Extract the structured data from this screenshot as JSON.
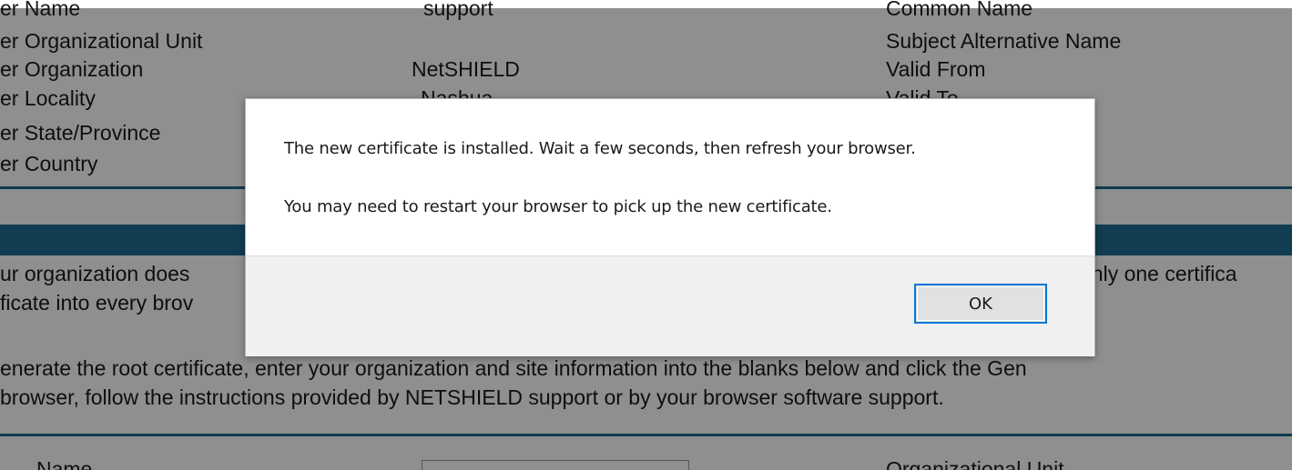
{
  "background": {
    "left_labels": [
      "er Name",
      "er Organizational Unit",
      "er Organization",
      "er Locality",
      "er State/Province",
      "er Country"
    ],
    "mid_values": [
      "support",
      "NetSHIELD",
      "Nashua"
    ],
    "right_labels": [
      "Common Name",
      "Subject Alternative Name",
      "Valid From",
      "Valid To"
    ],
    "paragraph1": [
      "ur organization does",
      "ficate into every brov",
      "only one certifica"
    ],
    "paragraph2": [
      "enerate the root certificate, enter your organization and site information into the blanks below and click the Gen",
      " browser, follow the instructions provided by NETSHIELD support or by your browser software support."
    ],
    "bottom_labels": [
      "  Name",
      "Organizational Unit"
    ]
  },
  "dialog": {
    "message_line1": "The new certificate is installed. Wait a few seconds, then refresh your browser.",
    "message_line2": "You may need to restart your browser to pick up the new certificate.",
    "ok_label": "OK"
  },
  "colors": {
    "accent_bar": "#1f6b91",
    "divider": "#1e6a8f",
    "focus_border": "#0078d7",
    "overlay": "rgba(0,0,0,0.44)"
  }
}
